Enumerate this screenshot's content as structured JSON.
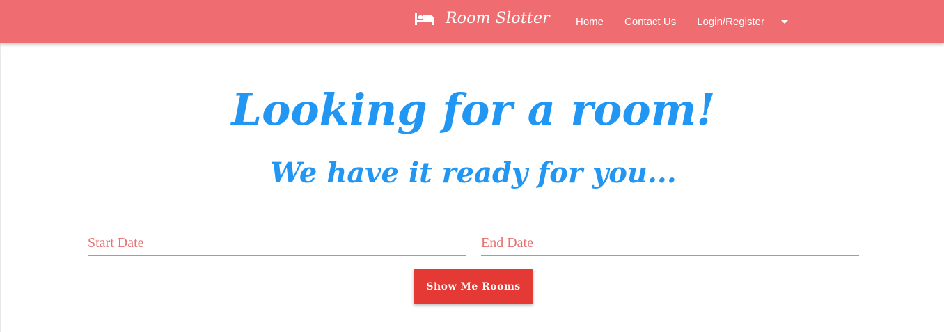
{
  "navbar": {
    "brand_icon": "bed-icon",
    "brand_name": "Room Slotter",
    "links": [
      {
        "label": "Home"
      },
      {
        "label": "Contact Us"
      },
      {
        "label": "Login/Register"
      }
    ],
    "dropdown_icon": "caret-down-icon"
  },
  "hero": {
    "headline": "Looking for a room!",
    "subheadline": "We have it ready for you..."
  },
  "search_form": {
    "start_date": {
      "value": "",
      "placeholder": "Start Date"
    },
    "end_date": {
      "value": "",
      "placeholder": "End Date"
    },
    "submit_label": "Show Me Rooms"
  },
  "colors": {
    "navbar_bg": "#ef6d70",
    "headline": "#2196f3",
    "placeholder": "#e57373",
    "button_bg": "#e53935"
  }
}
